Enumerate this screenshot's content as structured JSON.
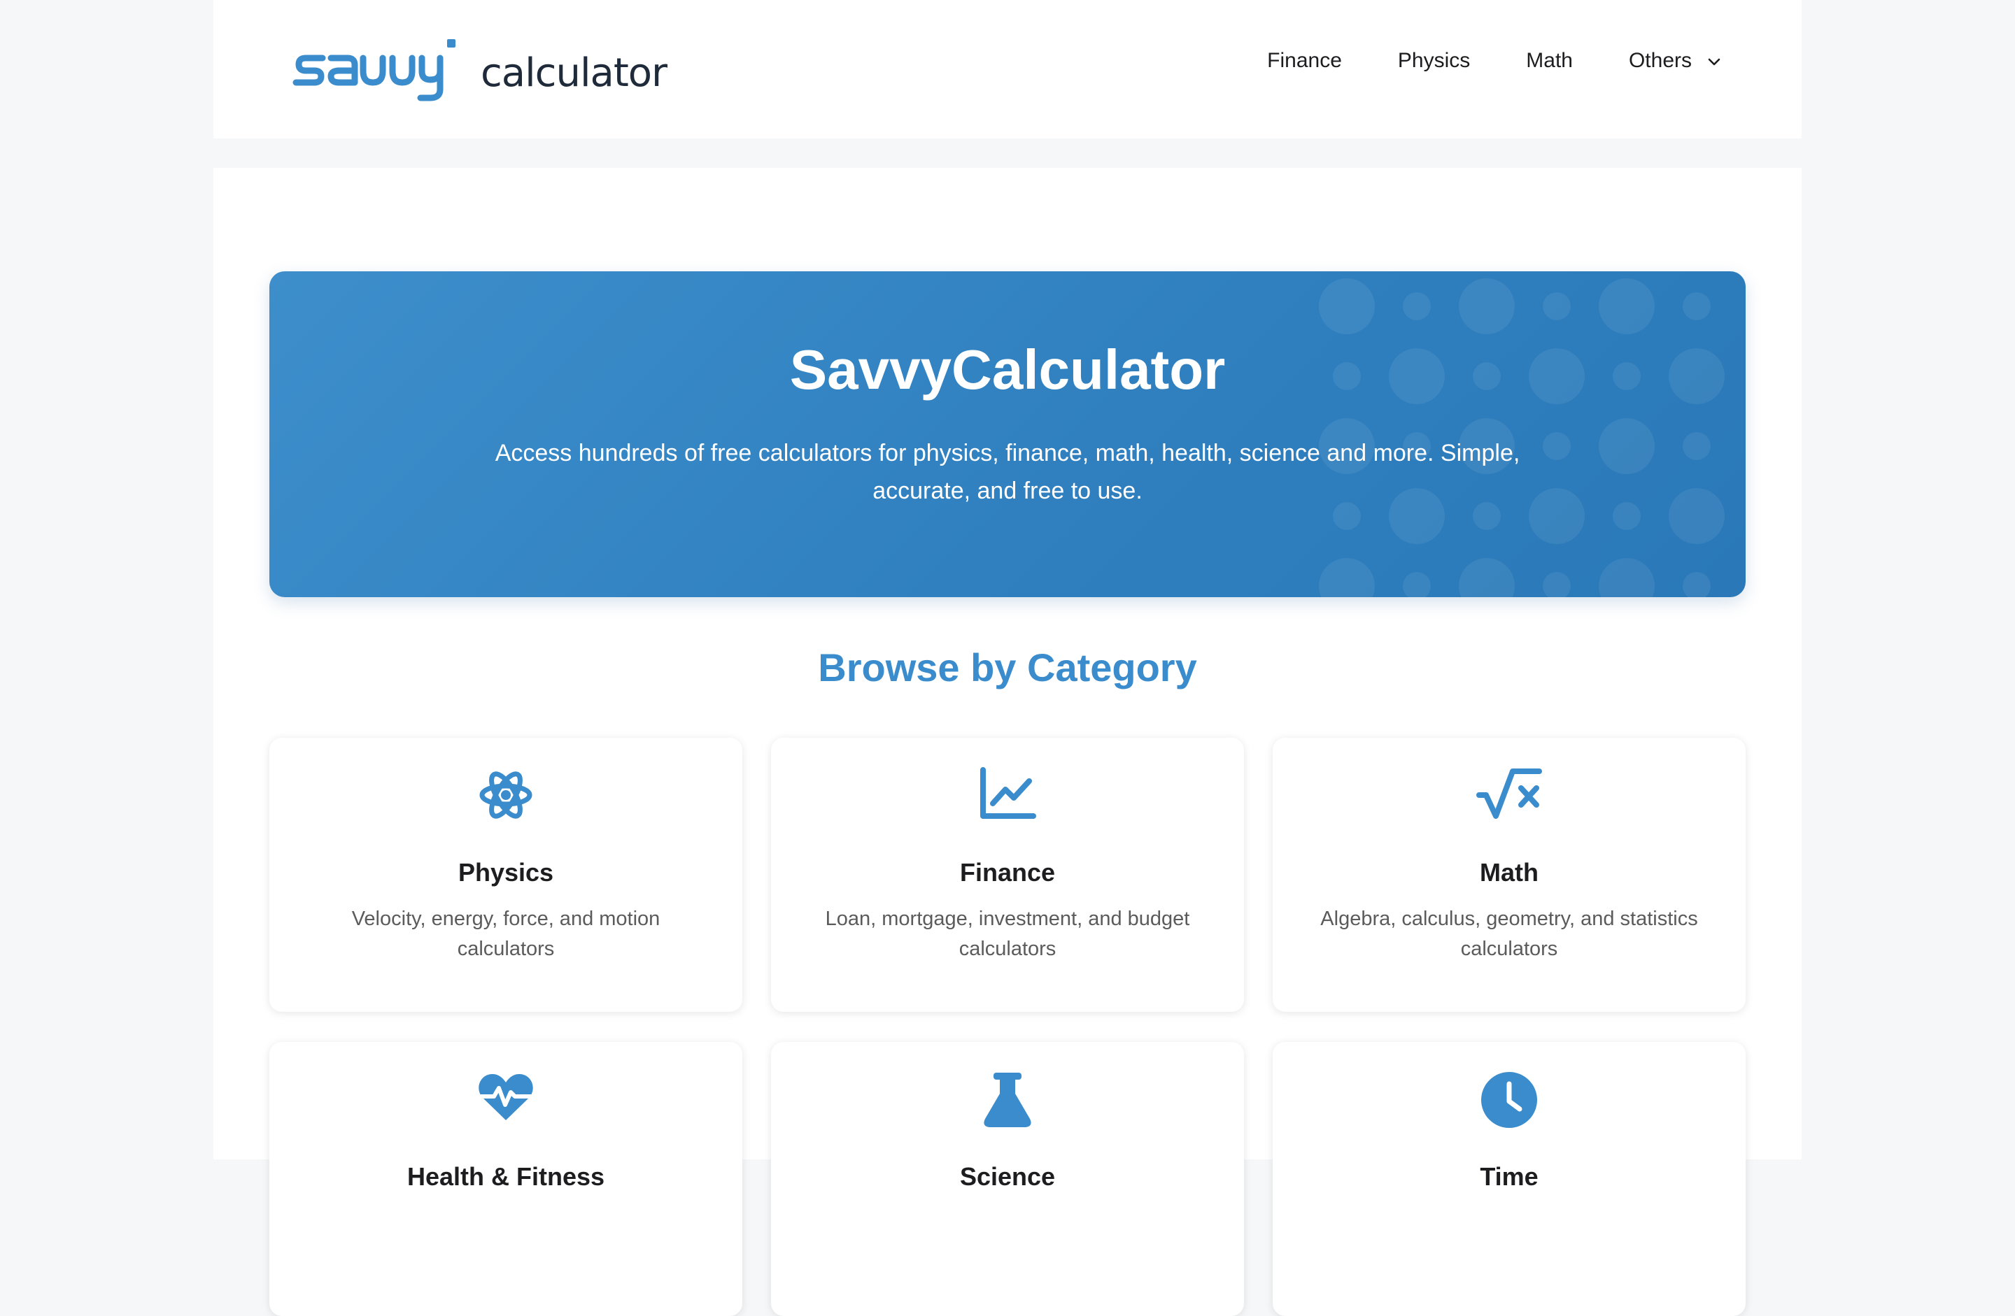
{
  "header": {
    "logo_word": "calculator",
    "logo_mark": "savvy",
    "nav": [
      {
        "label": "Finance"
      },
      {
        "label": "Physics"
      },
      {
        "label": "Math"
      },
      {
        "label": "Others"
      }
    ]
  },
  "hero": {
    "title": "SavvyCalculator",
    "subtitle": "Access hundreds of free calculators for physics, finance, math, health, science and more. Simple, accurate, and free to use."
  },
  "section": {
    "title": "Browse by Category"
  },
  "categories": [
    {
      "title": "Physics",
      "desc": "Velocity, energy, force, and motion calculators",
      "icon": "atom-icon"
    },
    {
      "title": "Finance",
      "desc": "Loan, mortgage, investment, and budget calculators",
      "icon": "chart-line-icon"
    },
    {
      "title": "Math",
      "desc": "Algebra, calculus, geometry, and statistics calculators",
      "icon": "square-root-icon"
    },
    {
      "title": "Health & Fitness",
      "desc": "",
      "icon": "heart-pulse-icon"
    },
    {
      "title": "Science",
      "desc": "",
      "icon": "flask-icon"
    },
    {
      "title": "Time",
      "desc": "",
      "icon": "clock-icon"
    }
  ],
  "colors": {
    "accent": "#3a8ccc",
    "hero_bg": "#3488c8",
    "page_bg": "#f6f7f9"
  }
}
